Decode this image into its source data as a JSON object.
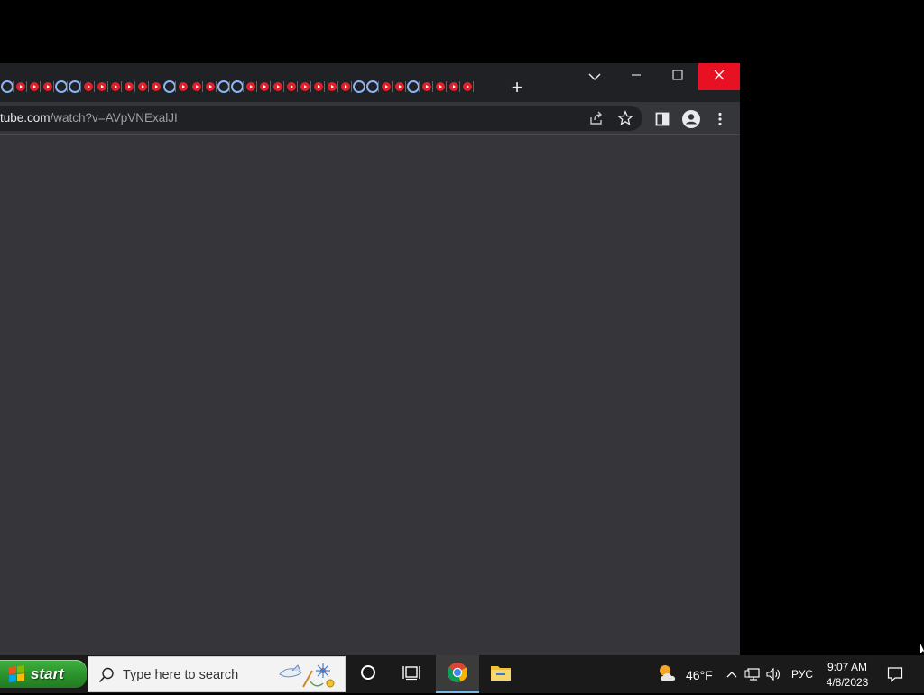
{
  "browser": {
    "tab_count": 35,
    "tab_states": [
      "loading",
      "favicon",
      "favicon",
      "favicon",
      "loading",
      "loading",
      "favicon",
      "favicon",
      "favicon",
      "favicon",
      "favicon",
      "favicon",
      "loading",
      "favicon",
      "favicon",
      "favicon",
      "loading",
      "loading",
      "favicon",
      "favicon",
      "favicon",
      "favicon",
      "favicon",
      "favicon",
      "favicon",
      "favicon",
      "loading",
      "loading",
      "favicon",
      "favicon",
      "loading",
      "favicon",
      "favicon",
      "favicon",
      "favicon"
    ],
    "new_tab_label": "+",
    "address": {
      "host": "tube.com",
      "path": "/watch?v=AVpVNExalJI"
    },
    "toolbar_icons": [
      "share-icon",
      "bookmark-star-icon",
      "side-panel-icon",
      "profile-icon",
      "menu-kebab-icon"
    ],
    "window_controls": [
      "tab-search-chevron-icon",
      "minimize-icon",
      "maximize-icon",
      "close-icon"
    ]
  },
  "taskbar": {
    "start_label": "start",
    "search_placeholder": "Type here to search",
    "apps": [
      "cortana-icon",
      "task-view-icon",
      "chrome-icon",
      "file-explorer-icon"
    ],
    "weather_temp": "46°F",
    "language": "РУС",
    "time": "9:07 AM",
    "date": "4/8/2023"
  },
  "colors": {
    "accent_close": "#e81123",
    "youtube_red": "#e0202a",
    "start_green": "#2a8f2a"
  }
}
